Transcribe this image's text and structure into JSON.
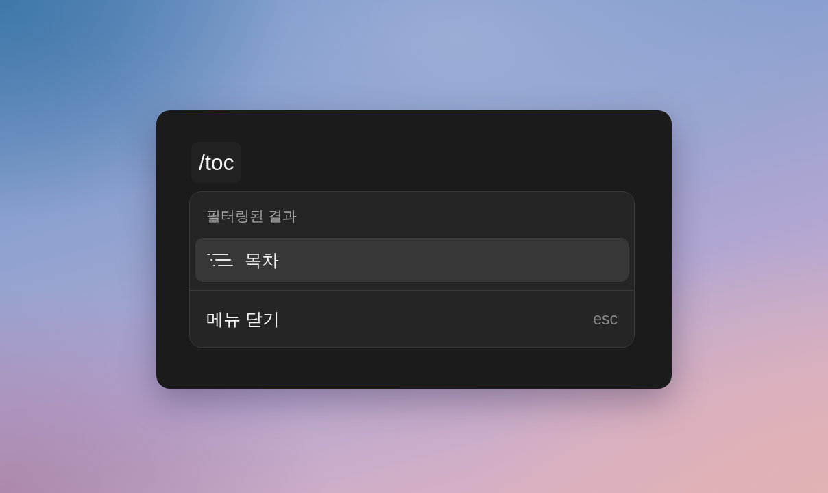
{
  "command": {
    "text": "/toc"
  },
  "menu": {
    "section_title": "필터링된 결과",
    "items": [
      {
        "label": "목차",
        "selected": true
      }
    ],
    "close": {
      "label": "메뉴 닫기",
      "shortcut": "esc"
    }
  }
}
